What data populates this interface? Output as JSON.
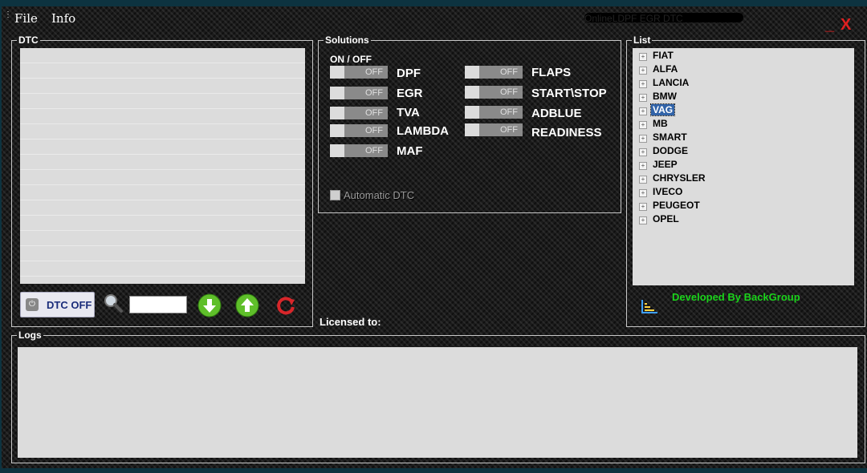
{
  "menu": {
    "file": "File",
    "info": "Info"
  },
  "title": "OnlineLDPF EGR DTC",
  "window_controls": {
    "minimize": "_",
    "close": "X"
  },
  "dtc": {
    "title": "DTC",
    "dtc_off_label": "DTC OFF",
    "search_value": ""
  },
  "solutions": {
    "title": "Solutions",
    "onoff_header": "ON  /  OFF",
    "items": [
      {
        "label": "DPF",
        "state": "OFF"
      },
      {
        "label": "EGR",
        "state": "OFF"
      },
      {
        "label": "TVA",
        "state": "OFF"
      },
      {
        "label": "LAMBDA",
        "state": "OFF"
      },
      {
        "label": "MAF",
        "state": "OFF"
      },
      {
        "label": "FLAPS",
        "state": "OFF"
      },
      {
        "label": "START\\STOP",
        "state": "OFF"
      },
      {
        "label": "ADBLUE",
        "state": "OFF"
      },
      {
        "label": "READINESS",
        "state": "OFF"
      }
    ],
    "automatic_dtc_label": "Automatic DTC",
    "automatic_dtc_checked": true
  },
  "licensed_to": "Licensed to:",
  "list": {
    "title": "List",
    "items": [
      "FIAT",
      "ALFA",
      "LANCIA",
      "BMW",
      "VAG",
      "MB",
      "SMART",
      "DODGE",
      "JEEP",
      "CHRYSLER",
      "IVECO",
      "PEUGEOT",
      "OPEL"
    ],
    "selected": "VAG",
    "developed_by": "Developed By BackGroup"
  },
  "logs": {
    "title": "Logs"
  },
  "colors": {
    "developed_text": "#1bd31b",
    "close_button": "#e02020",
    "selection": "#3163a8",
    "dtc_off_text": "#1a2c7a"
  },
  "icons": {
    "power": "power-icon",
    "search": "magnifier-icon",
    "download": "arrow-down-icon",
    "upload": "arrow-up-icon",
    "refresh": "refresh-icon",
    "developer": "chart-bars-icon"
  }
}
